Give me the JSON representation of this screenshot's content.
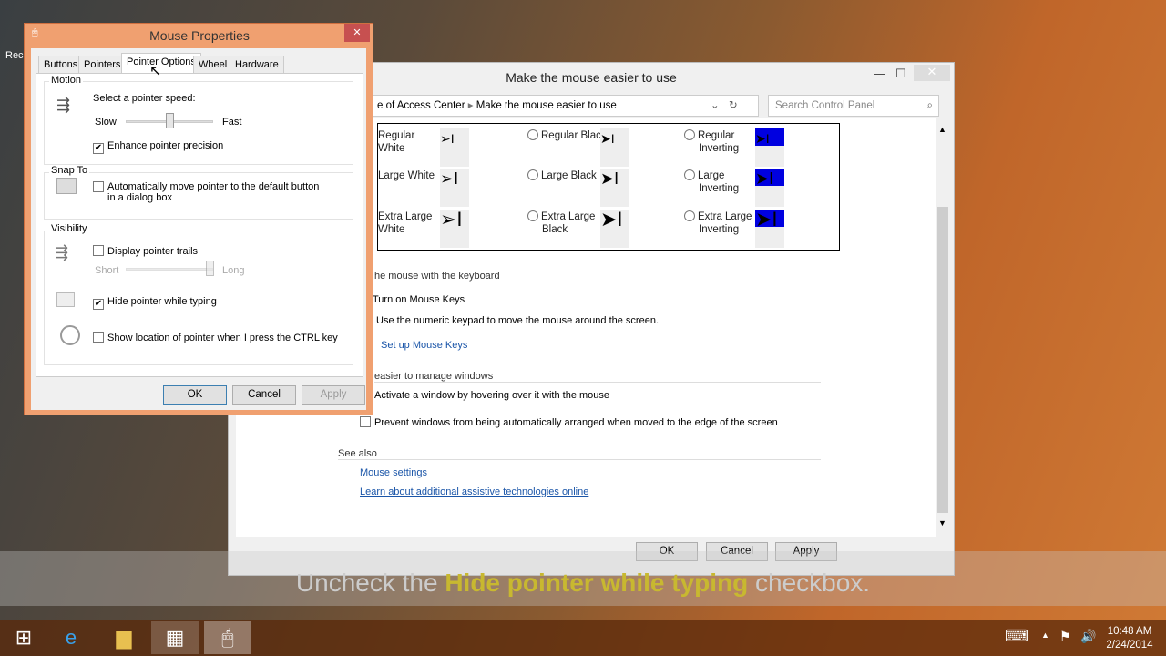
{
  "desktop": {
    "recycle_label": "Rec"
  },
  "ease_window": {
    "title": "Make the mouse easier to use",
    "breadcrumb": [
      "e of Access Center",
      "Make the mouse easier to use"
    ],
    "search_placeholder": "Search Control Panel",
    "schemes": [
      {
        "label": "Regular White",
        "l1": "Regular",
        "l2": "White"
      },
      {
        "label": "Regular Black",
        "l1": "Regular Black",
        "l2": ""
      },
      {
        "label": "Regular Inverting",
        "l1": "Regular",
        "l2": "Inverting"
      },
      {
        "label": "Large White",
        "l1": "Large White",
        "l2": ""
      },
      {
        "label": "Large Black",
        "l1": "Large Black",
        "l2": ""
      },
      {
        "label": "Large Inverting",
        "l1": "Large",
        "l2": "Inverting"
      },
      {
        "label": "Extra Large White",
        "l1": "Extra Large",
        "l2": "White"
      },
      {
        "label": "Extra Large Black",
        "l1": "Extra Large",
        "l2": "Black"
      },
      {
        "label": "Extra Large Inverting",
        "l1": "Extra Large",
        "l2": "Inverting"
      }
    ],
    "keyboard_section": "he mouse with the keyboard",
    "mouse_keys": "Turn on Mouse Keys",
    "mouse_keys_desc": "Use the numeric keypad to move the mouse around the screen.",
    "setup_mouse_keys": "Set up Mouse Keys",
    "windows_section": "easier to manage windows",
    "hover_activate": "Activate a window by hovering over it with the mouse",
    "prevent_arrange": "Prevent windows from being automatically arranged when moved to the edge of the screen",
    "see_also": "See also",
    "mouse_settings": "Mouse settings",
    "learn_more": "Learn about additional assistive technologies online",
    "ok": "OK",
    "cancel": "Cancel",
    "apply": "Apply"
  },
  "mouse_dialog": {
    "title": "Mouse Properties",
    "tabs": [
      "Buttons",
      "Pointers",
      "Pointer Options",
      "Wheel",
      "Hardware"
    ],
    "active_tab": "Pointer Options",
    "motion": "Motion",
    "speed_label": "Select a pointer speed:",
    "slow": "Slow",
    "fast": "Fast",
    "speed_value_percent": 50,
    "enhance": "Enhance pointer precision",
    "enhance_checked": true,
    "snap_to": "Snap To",
    "snap_auto": "Automatically move pointer to the default button in a dialog box",
    "snap_checked": false,
    "visibility": "Visibility",
    "trails": "Display pointer trails",
    "trails_checked": false,
    "short": "Short",
    "long": "Long",
    "trail_value_percent": 100,
    "hide_typing": "Hide pointer while typing",
    "hide_checked": true,
    "show_ctrl": "Show location of pointer when I press the CTRL key",
    "ctrl_checked": false,
    "ok": "OK",
    "cancel": "Cancel",
    "apply": "Apply"
  },
  "caption": {
    "pre": "Uncheck the ",
    "highlight": "Hide pointer while typing",
    "post": " checkbox."
  },
  "taskbar": {
    "time": "10:48 AM",
    "date": "2/24/2014"
  }
}
